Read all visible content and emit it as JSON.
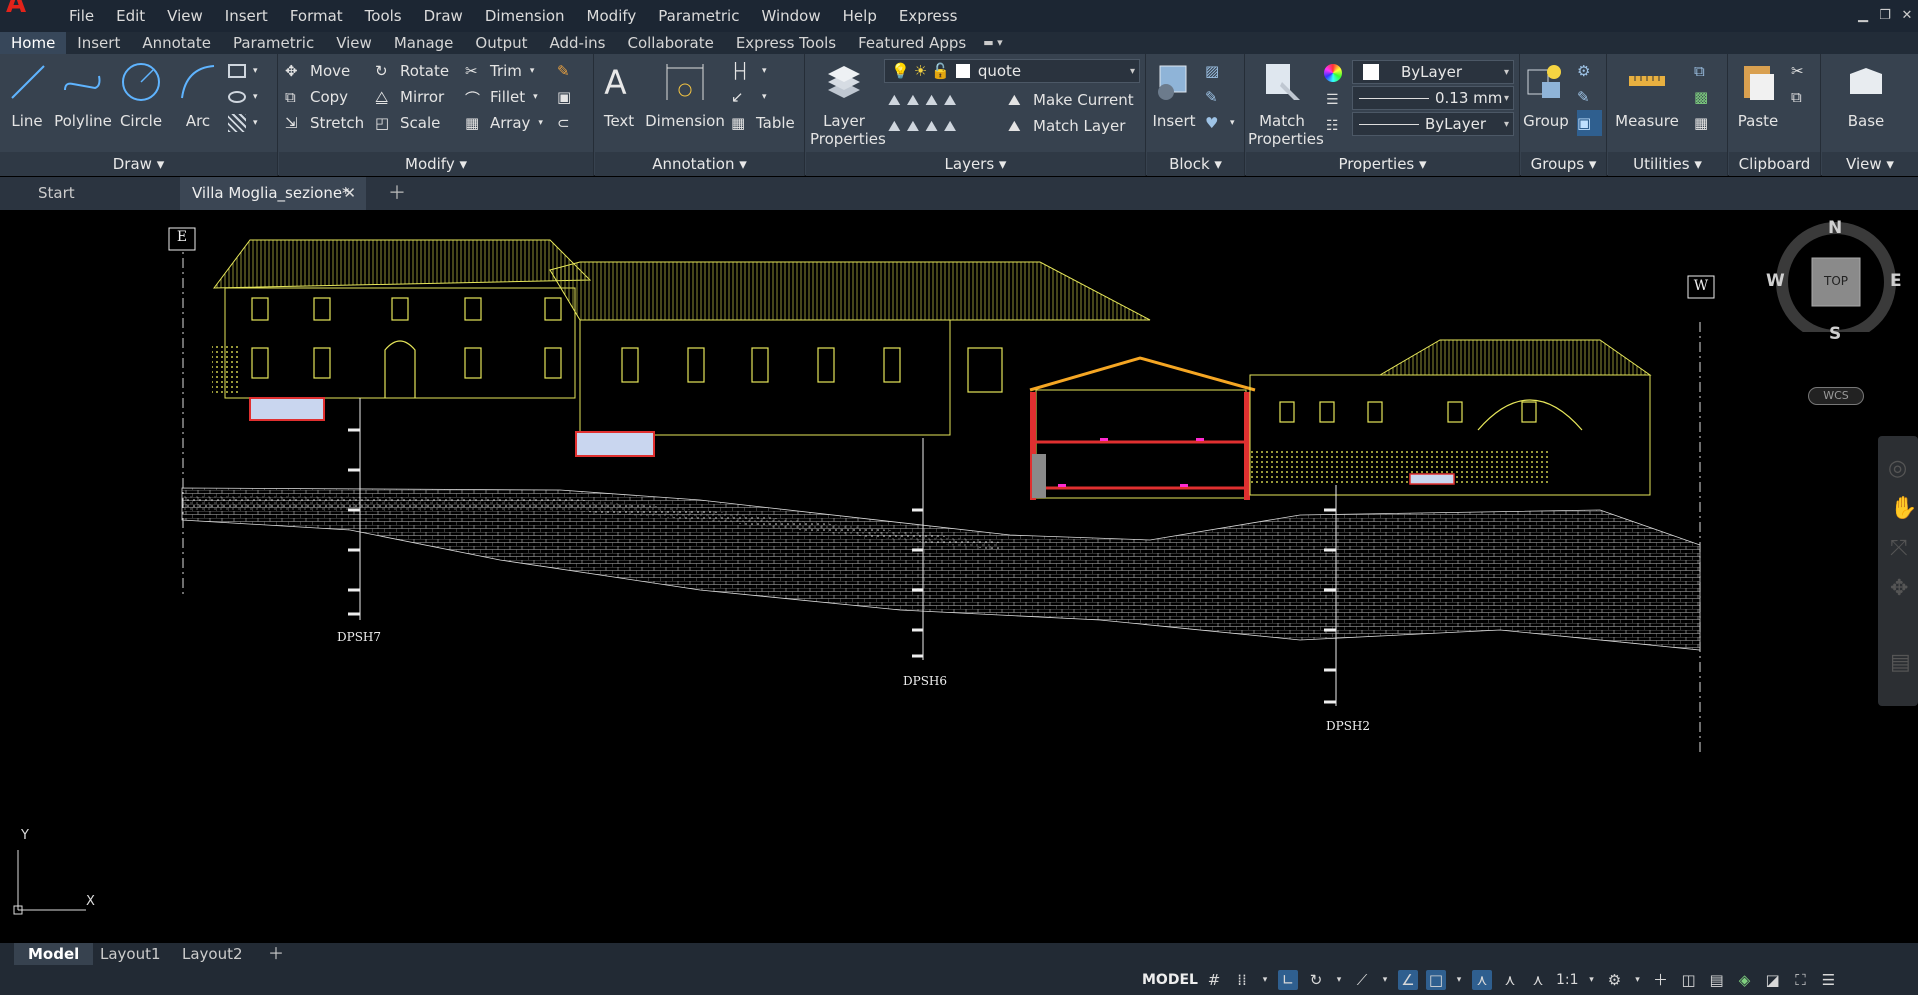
{
  "app": {
    "logo": "A"
  },
  "menu": [
    "File",
    "Edit",
    "View",
    "Insert",
    "Format",
    "Tools",
    "Draw",
    "Dimension",
    "Modify",
    "Parametric",
    "Window",
    "Help",
    "Express"
  ],
  "ribbon_tabs": [
    "Home",
    "Insert",
    "Annotate",
    "Parametric",
    "View",
    "Manage",
    "Output",
    "Add-ins",
    "Collaborate",
    "Express Tools",
    "Featured Apps"
  ],
  "active_ribbon_tab": "Home",
  "panels": {
    "draw": {
      "title": "Draw ▾",
      "line": "Line",
      "polyline": "Polyline",
      "circle": "Circle",
      "arc": "Arc"
    },
    "modify": {
      "title": "Modify ▾",
      "move": "Move",
      "rotate": "Rotate",
      "trim": "Trim",
      "copy": "Copy",
      "mirror": "Mirror",
      "fillet": "Fillet",
      "stretch": "Stretch",
      "scale": "Scale",
      "array": "Array"
    },
    "annotation": {
      "title": "Annotation ▾",
      "text": "Text",
      "dimension": "Dimension",
      "table": "Table"
    },
    "layers": {
      "title": "Layers ▾",
      "layer_properties_1": "Layer",
      "layer_properties_2": "Properties",
      "current_layer": "quote",
      "make_current": "Make Current",
      "match_layer": "Match Layer"
    },
    "block": {
      "title": "Block ▾",
      "insert": "Insert"
    },
    "properties": {
      "title": "Properties ▾",
      "match_1": "Match",
      "match_2": "Properties",
      "color": "ByLayer",
      "lineweight": "0.13 mm",
      "linetype": "ByLayer"
    },
    "groups": {
      "title": "Groups ▾",
      "group": "Group"
    },
    "utilities": {
      "title": "Utilities ▾",
      "measure": "Measure"
    },
    "clipboard": {
      "title": "Clipboard",
      "paste": "Paste"
    },
    "view": {
      "title": "View ▾",
      "base": "Base"
    }
  },
  "doc_tabs": {
    "start": "Start",
    "current": "Villa Moglia_sezione*"
  },
  "drawing": {
    "label_east": "E",
    "label_west": "W",
    "boreholes": [
      "DPSH7",
      "DPSH6",
      "DPSH2"
    ]
  },
  "viewcube": {
    "n": "N",
    "s": "S",
    "e": "E",
    "w": "W",
    "face": "TOP",
    "wcs": "WCS"
  },
  "ucs": {
    "x": "X",
    "y": "Y"
  },
  "layout_tabs": [
    "Model",
    "Layout1",
    "Layout2"
  ],
  "status": {
    "model": "MODEL",
    "scale": "1:1"
  },
  "colors": {
    "accent": "#2f5f8f",
    "drawing_yellow": "#e6e65a",
    "section_red": "#e03030",
    "magenta": "#ff2bd0"
  }
}
